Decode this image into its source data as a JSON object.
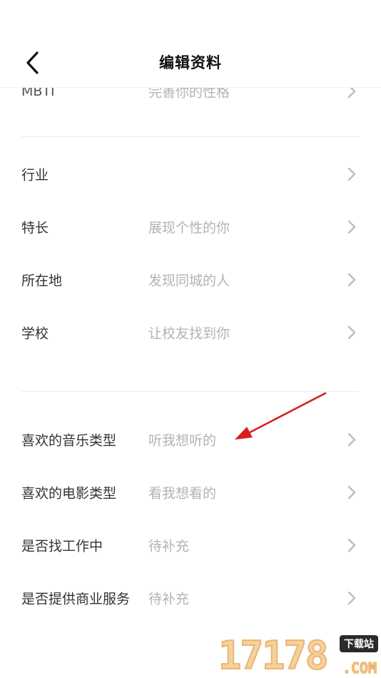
{
  "header": {
    "title": "编辑资料",
    "back_icon": "chevron-left-icon"
  },
  "partial_row": {
    "label": "MBTI",
    "value": "完善你的性格"
  },
  "group_2": [
    {
      "label": "行业",
      "value": ""
    },
    {
      "label": "特长",
      "value": "展现个性的你"
    },
    {
      "label": "所在地",
      "value": "发现同城的人"
    },
    {
      "label": "学校",
      "value": "让校友找到你"
    }
  ],
  "group_3": [
    {
      "label": "喜欢的音乐类型",
      "value": "听我想听的"
    },
    {
      "label": "喜欢的电影类型",
      "value": "看我想看的"
    },
    {
      "label": "是否找工作中",
      "value": "待补充"
    },
    {
      "label": "是否提供商业服务",
      "value": "待补充"
    }
  ],
  "annotation": {
    "arrow_color": "#d81e1e"
  },
  "watermark": {
    "digits": "17178",
    "tag": "下载站",
    "suffix": ".COM"
  },
  "colors": {
    "label": "#333333",
    "value_placeholder": "#b3b3b3",
    "chevron": "#bdbdbd",
    "divider": "#ececec"
  }
}
